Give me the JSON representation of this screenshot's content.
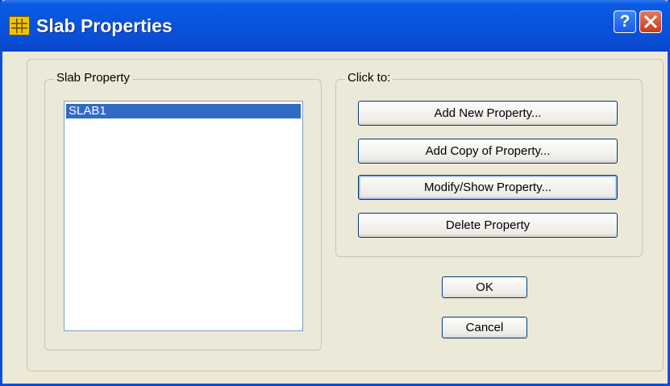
{
  "window": {
    "title": "Slab Properties"
  },
  "titlebar": {
    "help_label": "?",
    "close_label": "X"
  },
  "slab_property": {
    "group_label": "Slab Property",
    "items": [
      {
        "label": "SLAB1",
        "selected": true
      }
    ]
  },
  "click_to": {
    "group_label": "Click to:",
    "buttons": {
      "add_new": "Add New Property...",
      "add_copy": "Add Copy of Property...",
      "modify_show": "Modify/Show Property...",
      "delete": "Delete Property"
    }
  },
  "dialog_buttons": {
    "ok": "OK",
    "cancel": "Cancel"
  },
  "colors": {
    "titlebar": "#0A4FD8",
    "selection": "#316AC5",
    "dialog_bg": "#ECE9D8",
    "close": "#C73A1A"
  },
  "icons": {
    "app": "grid-app-icon",
    "help": "help-icon",
    "close": "close-icon"
  }
}
